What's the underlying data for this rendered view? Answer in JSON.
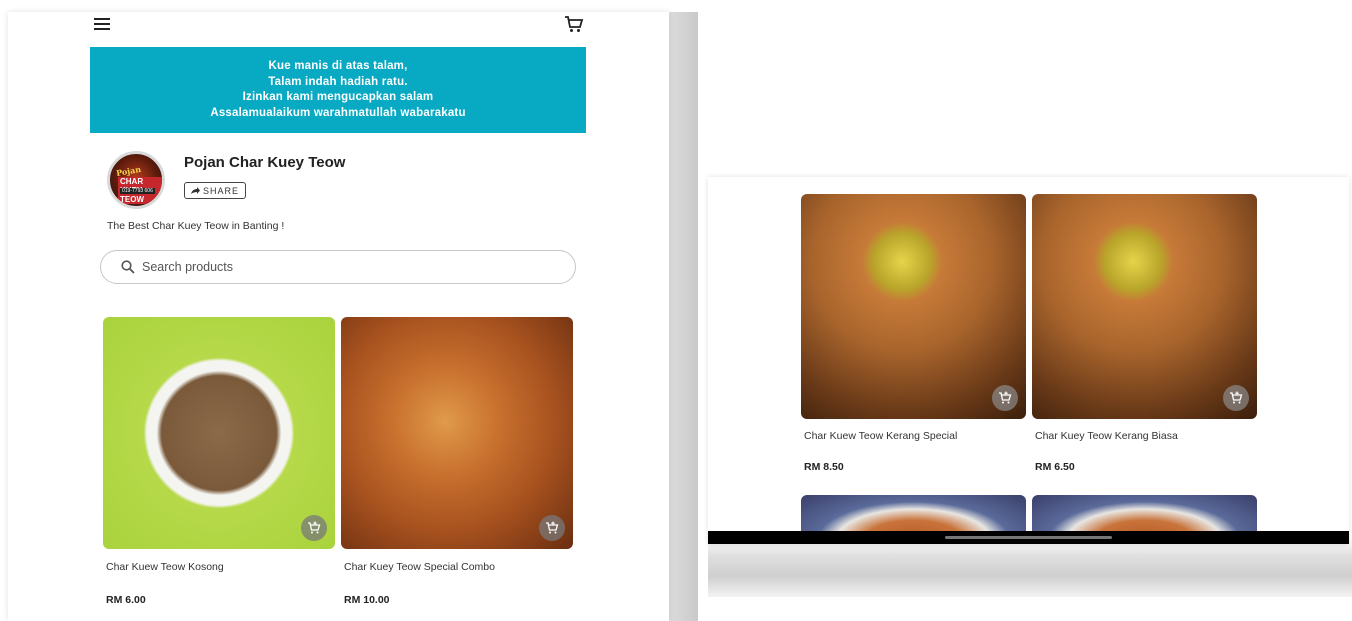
{
  "left": {
    "header": {
      "menu_icon": "hamburger-menu-icon",
      "cart_icon": "cart-icon"
    },
    "banner": {
      "lines": [
        "Kue manis di atas talam,",
        "Talam indah hadiah ratu.",
        "Izinkan kami mengucapkan salam",
        "Assalamualaikum warahmatullah wabarakatu"
      ],
      "color": "#08a9c3"
    },
    "store": {
      "name": "Pojan Char Kuey Teow",
      "share_label": "SHARE",
      "tagline": "The Best Char Kuey Teow in Banting !",
      "logo_text": [
        "Pojan",
        "CHAR KUEY TEOW",
        "019-7793 606"
      ]
    },
    "search": {
      "placeholder": "Search products"
    },
    "products": [
      {
        "name": "Char Kuew Teow Kosong",
        "price": "RM 6.00"
      },
      {
        "name": "Char Kuey Teow Special Combo",
        "price": "RM 10.00"
      }
    ]
  },
  "right": {
    "products": [
      {
        "name": "Char Kuew Teow Kerang Special",
        "price": "RM 8.50"
      },
      {
        "name": "Char Kuey Teow Kerang Biasa",
        "price": "RM 6.50"
      }
    ]
  }
}
